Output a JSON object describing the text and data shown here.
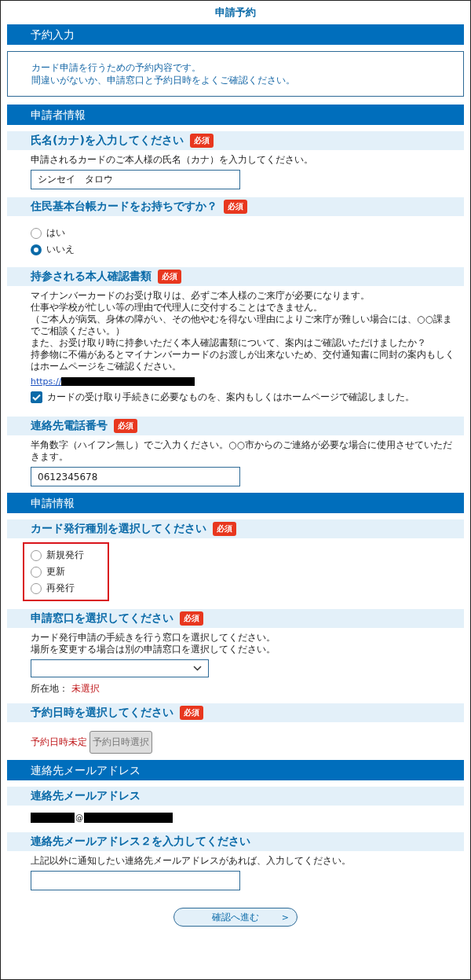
{
  "title": "申請予約",
  "sections": [
    {
      "heading": "予約入力",
      "notice": [
        "カード申請を行うための予約内容です。",
        "間違いがないか、申請窓口と予約日時をよくご確認ください。"
      ]
    },
    {
      "heading": "申請者情報",
      "fields": [
        {
          "kind": "text",
          "label": "氏名(カナ)を入力してください",
          "badge": "必須",
          "description": [
            "申請されるカードのご本人様の氏名（カナ）を入力してください。"
          ],
          "value": "シンセイ　タロウ"
        },
        {
          "kind": "radio",
          "label": "住民基本台帳カードをお持ちですか？",
          "badge": "必須",
          "highlighted": false,
          "options": [
            {
              "label": "はい",
              "selected": false
            },
            {
              "label": "いいえ",
              "selected": true
            }
          ]
        },
        {
          "kind": "confirm",
          "label": "持参される本人確認書類",
          "badge": "必須",
          "description": [
            "マイナンバーカードのお受け取りは、必ずご本人様のご来庁が必要になります。",
            "仕事や学校が忙しい等の理由で代理人に交付することはできません。",
            "（ご本人が病気、身体の障がい、その他やむを得ない理由によりご来庁が難しい場合には、○○課までご相談ください。）",
            "また、お受け取り時に持参いただく本人確認書類について、案内はご確認いただけましたか？",
            "持参物に不備があるとマイナンバーカードのお渡しが出来ないため、交付通知書に同封の案内もしくはホームページをご確認ください。"
          ],
          "link": {
            "text": "https://"
          },
          "checkbox": {
            "label": "カードの受け取り手続きに必要なものを、案内もしくはホームページで確認しました。",
            "checked": true
          }
        },
        {
          "kind": "text",
          "label": "連絡先電話番号",
          "badge": "必須",
          "description": [
            "半角数字（ハイフン無し）でご入力ください。○○市からのご連絡が必要な場合に使用させていただきます。"
          ],
          "value": "0612345678"
        }
      ]
    },
    {
      "heading": "申請情報",
      "fields": [
        {
          "kind": "radio",
          "label": "カード発行種別を選択してください",
          "badge": "必須",
          "highlighted": true,
          "options": [
            {
              "label": "新規発行",
              "selected": false
            },
            {
              "label": "更新",
              "selected": false
            },
            {
              "label": "再発行",
              "selected": false
            }
          ]
        },
        {
          "kind": "select",
          "label": "申請窓口を選択してください",
          "badge": "必須",
          "description": [
            "カード発行申請の手続きを行う窓口を選択してください。",
            "場所を変更する場合は別の申請窓口を選択してください。"
          ],
          "location_label": "所在地：",
          "location_value": "未選択"
        },
        {
          "kind": "date",
          "label": "予約日時を選択してください",
          "badge": "必須",
          "status": "予約日時未定",
          "button": {
            "label": "予約日時選択",
            "disabled": true
          }
        }
      ]
    },
    {
      "heading": "連絡先メールアドレス",
      "fields": [
        {
          "kind": "email",
          "label": "連絡先メールアドレス",
          "at": "@"
        },
        {
          "kind": "text",
          "label": "連絡先メールアドレス２を入力してください",
          "description": [
            "上記以外に通知したい連絡先メールアドレスがあれば、入力してください。"
          ]
        }
      ]
    }
  ],
  "submit": {
    "label": "確認へ進む",
    "arrow": ">"
  }
}
